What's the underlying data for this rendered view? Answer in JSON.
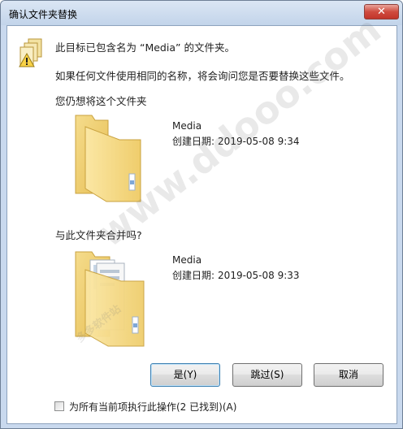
{
  "window": {
    "title": "确认文件夹替换",
    "close_glyph": "✕"
  },
  "background_tabs": [
    "...",
    "...",
    "..."
  ],
  "message": {
    "line1": "此目标已包含名为 “Media” 的文件夹。",
    "line2": "如果任何文件使用相同的名称，将会询问您是否要替换这些文件。",
    "line3": "您仍想将这个文件夹",
    "line4": "与此文件夹合并吗?"
  },
  "target_folder": {
    "name": "Media",
    "created_label": "创建日期:",
    "created_value": "2019-05-08 9:34",
    "icon": "empty-folder-icon"
  },
  "source_folder": {
    "name": "Media",
    "created_label": "创建日期:",
    "created_value": "2019-05-08 9:33",
    "icon": "full-folder-icon"
  },
  "buttons": {
    "yes": "是(Y)",
    "skip": "跳过(S)",
    "cancel": "取消"
  },
  "apply_all": {
    "label": "为所有当前项执行此操作(2 已找到)(A)",
    "checked": false
  },
  "watermark": {
    "url": "www.ddooo.com",
    "site": "多多软件站"
  },
  "colors": {
    "accent": "#3c7fb1",
    "window_frame": "#c9d9ee",
    "close_button": "#c9443a",
    "folder": "#f2d27a"
  }
}
